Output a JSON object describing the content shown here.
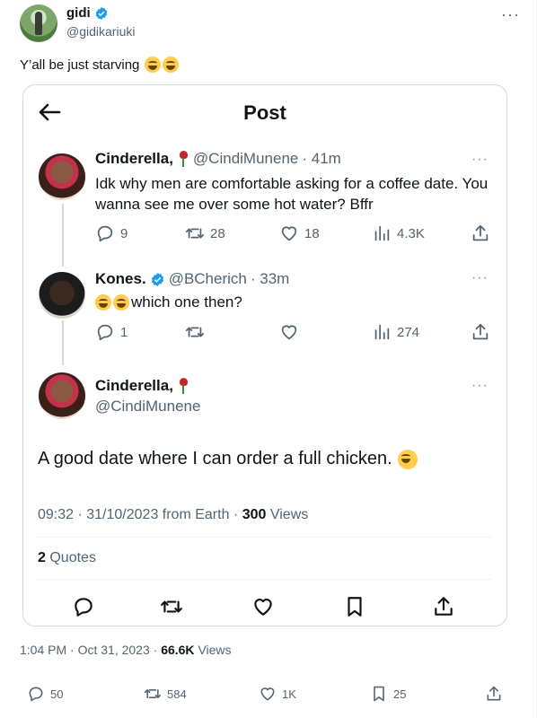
{
  "outer_tweet": {
    "author_name": "gidi",
    "author_handle": "@gidikariuki",
    "more": "···",
    "text": "Y’all be just starving",
    "time": "1:04 PM · Oct 31, 2023 ·",
    "views_count": "66.6K",
    "views_label": "Views",
    "actions": {
      "replies": "50",
      "retweets": "584",
      "likes": "1K",
      "bookmarks": "25"
    }
  },
  "embedded": {
    "header_title": "Post",
    "tweets": [
      {
        "name": "Cinderella,",
        "handle": "@CindiMunene",
        "time": "· 41m",
        "text": "Idk why men are comfortable asking for a coffee date. You wanna see me over some hot water? Bffr",
        "replies": "9",
        "retweets": "28",
        "likes": "18",
        "views": "4.3K"
      },
      {
        "name": "Kones.",
        "handle": "@BCherich",
        "time": "· 33m",
        "text": "which one then?",
        "replies": "1",
        "retweets": "",
        "likes": "",
        "views": "274"
      }
    ],
    "main": {
      "name": "Cinderella,",
      "handle": "@CindiMunene",
      "text": "A good date where I can order a full chicken.",
      "timestamp": "09:32 · 31/10/2023 from Earth ·",
      "views_count": "300",
      "views_label": "Views",
      "quotes_count": "2",
      "quotes_label": "Quotes"
    }
  },
  "colors": {
    "verified": "#1d9bf0",
    "muted": "#536471",
    "border": "#cfd9de"
  }
}
